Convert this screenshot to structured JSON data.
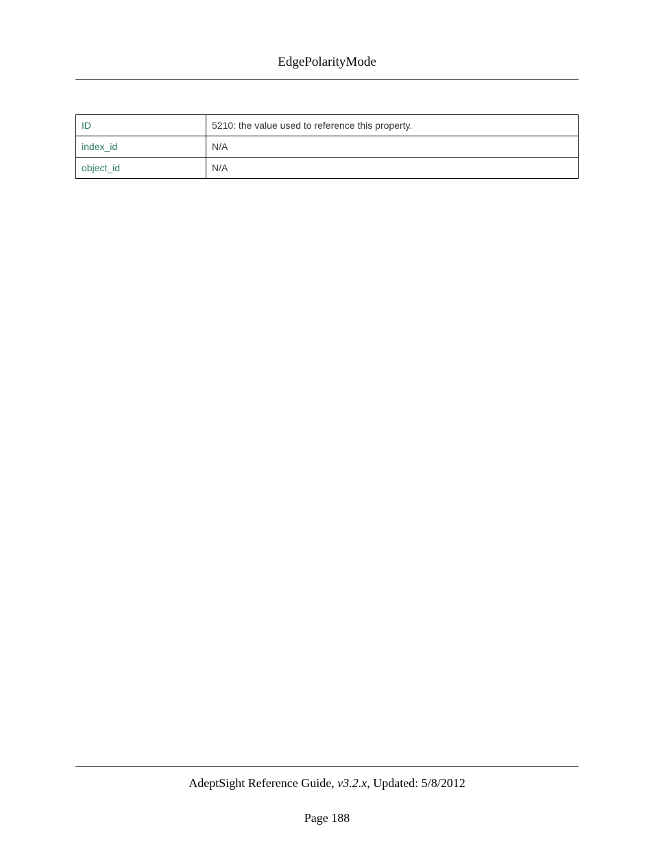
{
  "header": {
    "title": "EdgePolarityMode"
  },
  "table": {
    "rows": [
      {
        "key": "ID",
        "value": "5210: the value used to reference this property."
      },
      {
        "key": "index_id",
        "value": "N/A"
      },
      {
        "key": "object_id",
        "value": "N/A"
      }
    ]
  },
  "footer": {
    "guide_name": "AdeptSight Reference Guide",
    "version": ", v3.2.x",
    "updated_label": ", Updated: ",
    "updated_date": "5/8/2012",
    "page_label": "Page ",
    "page_number": "188"
  }
}
